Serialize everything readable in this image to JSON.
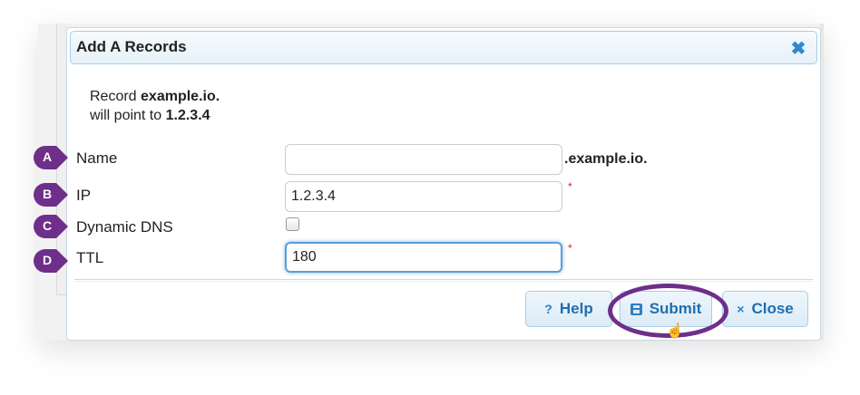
{
  "dialog": {
    "title": "Add A Records",
    "record_prefix": "Record",
    "record_domain": "example.io.",
    "point_prefix": "will point to",
    "point_ip": "1.2.3.4"
  },
  "fields": {
    "name": {
      "label": "Name",
      "value": "",
      "suffix": ".example.io."
    },
    "ip": {
      "label": "IP",
      "value": "1.2.3.4",
      "required_mark": "*"
    },
    "dynamic_dns": {
      "label": "Dynamic DNS",
      "checked": false
    },
    "ttl": {
      "label": "TTL",
      "value": "180",
      "required_mark": "*"
    }
  },
  "buttons": {
    "help": {
      "label": "Help",
      "icon": "question-icon",
      "icon_glyph": "?"
    },
    "submit": {
      "label": "Submit",
      "icon": "save-icon"
    },
    "close": {
      "label": "Close",
      "icon": "close-icon",
      "icon_glyph": "×"
    }
  },
  "titlebar_close_glyph": "✖",
  "annotations": {
    "badges": [
      "A",
      "B",
      "C",
      "D"
    ],
    "badge_color": "#6e2f8a",
    "highlight_color": "#6e2f8a"
  },
  "colors": {
    "accent": "#2f7fc2",
    "required": "#dd2222",
    "focus": "#5b9dd9"
  }
}
